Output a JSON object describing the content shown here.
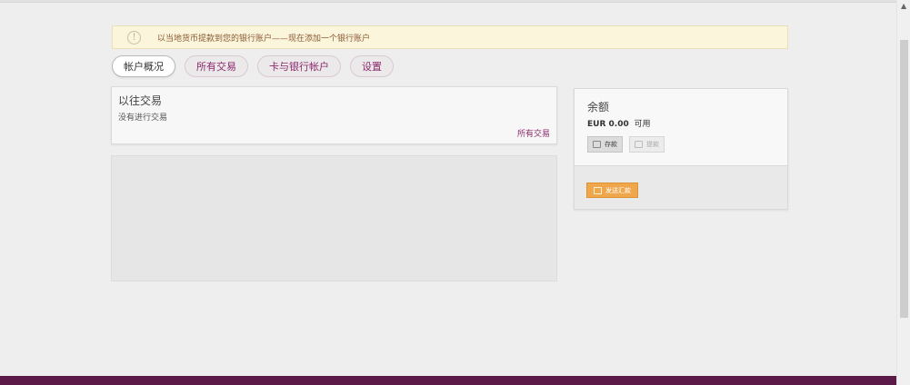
{
  "alert": {
    "icon": "info-icon",
    "icon_glyph": "!",
    "text": "以当地货币提款到您的银行账户——现在添加一个银行账户"
  },
  "tabs": [
    {
      "label": "帐户概况",
      "active": true
    },
    {
      "label": "所有交易",
      "active": false
    },
    {
      "label": "卡与银行帐户",
      "active": false
    },
    {
      "label": "设置",
      "active": false
    }
  ],
  "transactions": {
    "title": "以往交易",
    "empty_text": "没有进行交易",
    "link": "所有交易"
  },
  "balance": {
    "title": "余额",
    "amount": "EUR 0.00",
    "available": "可用",
    "deposit_label": "存款",
    "withdraw_label": "提款",
    "send_label": "发送汇款"
  },
  "colors": {
    "accent": "#8b2a6c",
    "footer": "#5b1a48",
    "alert_bg": "#fbf5dc",
    "orange": "#f0a64a"
  }
}
